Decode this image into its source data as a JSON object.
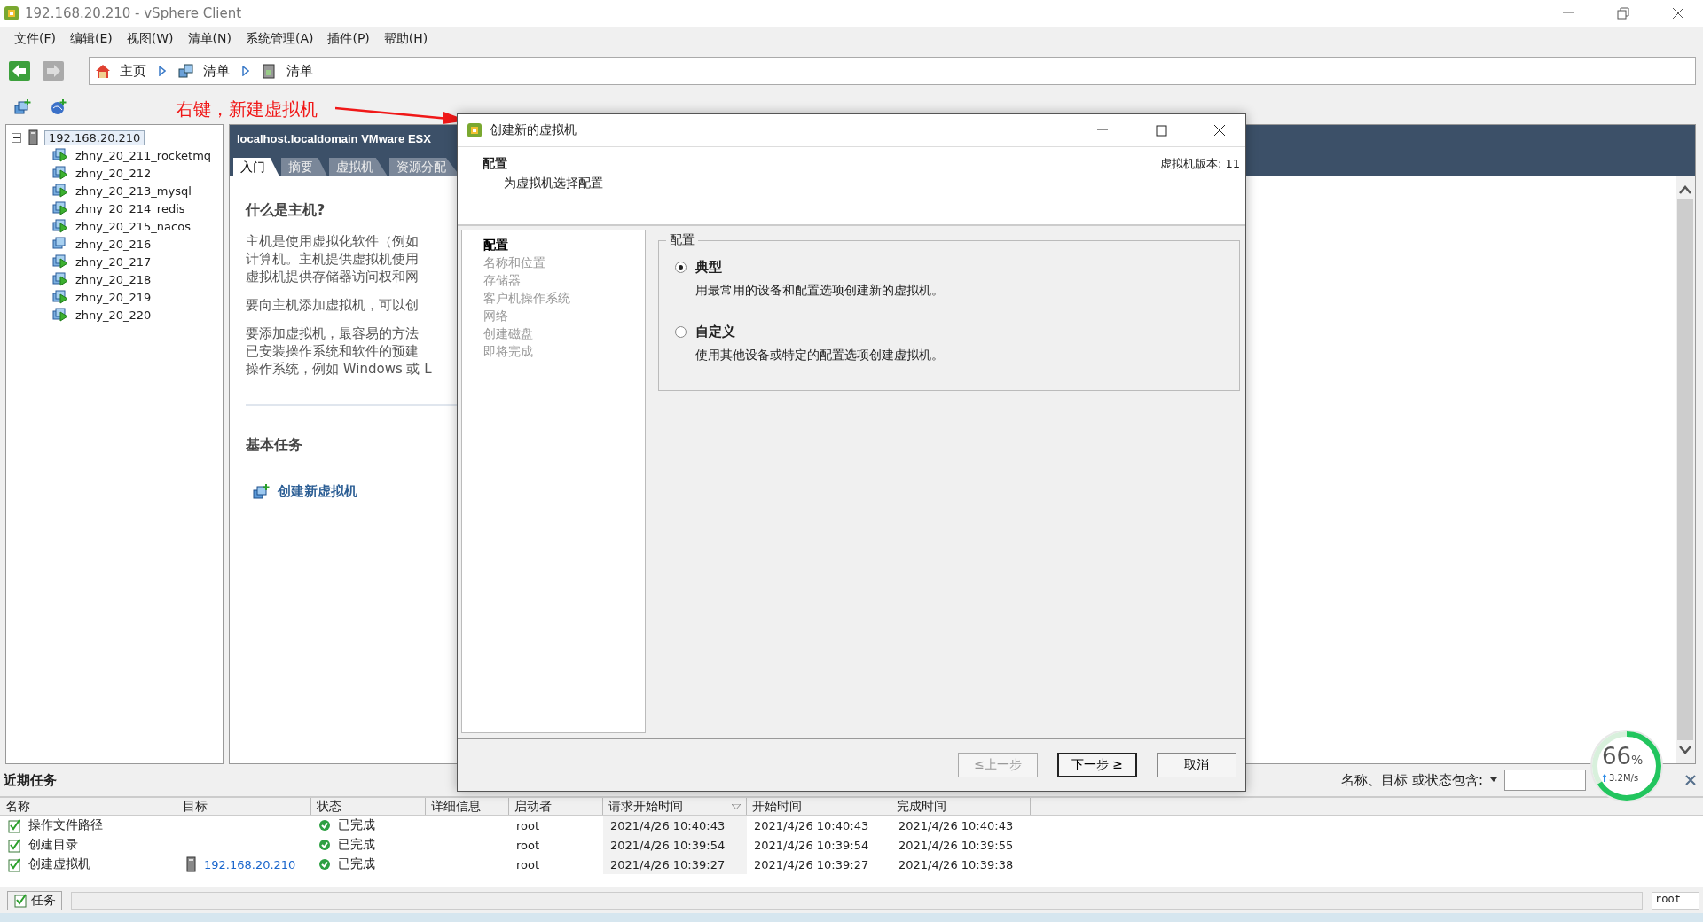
{
  "window": {
    "title": "192.168.20.210 - vSphere Client"
  },
  "menu": [
    "文件(F)",
    "编辑(E)",
    "视图(W)",
    "清单(N)",
    "系统管理(A)",
    "插件(P)",
    "帮助(H)"
  ],
  "breadcrumb": [
    {
      "kind": "home",
      "label": "主页"
    },
    {
      "kind": "inventory",
      "label": "清单"
    },
    {
      "kind": "host",
      "label": "清单"
    }
  ],
  "annotation": {
    "text": "右键，新建虚拟机"
  },
  "tree": {
    "label": "192.168.20.210",
    "expanded": true,
    "selected": true,
    "children": [
      {
        "label": "zhny_20_211_rocketmq",
        "powered_on": true,
        "selected": false
      },
      {
        "label": "zhny_20_212",
        "powered_on": true,
        "selected": false
      },
      {
        "label": "zhny_20_213_mysql",
        "powered_on": true,
        "selected": false
      },
      {
        "label": "zhny_20_214_redis",
        "powered_on": true,
        "selected": false
      },
      {
        "label": "zhny_20_215_nacos",
        "powered_on": true,
        "selected": false
      },
      {
        "label": "zhny_20_216",
        "powered_on": false,
        "selected": false
      },
      {
        "label": "zhny_20_217",
        "powered_on": true,
        "selected": false
      },
      {
        "label": "zhny_20_218",
        "powered_on": true,
        "selected": false
      },
      {
        "label": "zhny_20_219",
        "powered_on": true,
        "selected": false
      },
      {
        "label": "zhny_20_220",
        "powered_on": true,
        "selected": false
      }
    ]
  },
  "content": {
    "header": "localhost.localdomain VMware ESX",
    "tabs": [
      {
        "label": "入门",
        "selected": true
      },
      {
        "label": "摘要",
        "selected": false
      },
      {
        "label": "虚拟机",
        "selected": false
      },
      {
        "label": "资源分配",
        "selected": false
      }
    ],
    "heading": "什么是主机?",
    "paragraphs": [
      [
        "主机是使用虚拟化软件（例如",
        "计算机。主机提供虚拟机使用",
        "虚拟机提供存储器访问权和网"
      ],
      [
        "要向主机添加虚拟机，可以创"
      ],
      [
        "要添加虚拟机，最容易的方法",
        "已安装操作系统和软件的预建",
        "操作系统，例如 Windows 或 L"
      ]
    ],
    "tasks_heading": "基本任务",
    "task_link": "创建新虚拟机"
  },
  "dialog": {
    "title": "创建新的虚拟机",
    "header_title": "配置",
    "header_subtitle": "为虚拟机选择配置",
    "version": "虚拟机版本: 11",
    "steps": [
      {
        "label": "配置",
        "selected": true
      },
      {
        "label": "名称和位置",
        "selected": false
      },
      {
        "label": "存储器",
        "selected": false
      },
      {
        "label": "客户机操作系统",
        "selected": false
      },
      {
        "label": "网络",
        "selected": false
      },
      {
        "label": "创建磁盘",
        "selected": false
      },
      {
        "label": "即将完成",
        "selected": false
      }
    ],
    "group_label": "配置",
    "options": [
      {
        "title": "典型",
        "description": "用最常用的设备和配置选项创建新的虚拟机。",
        "selected": true
      },
      {
        "title": "自定义",
        "description": "使用其他设备或特定的配置选项创建虚拟机。",
        "selected": false
      }
    ],
    "buttons": [
      {
        "label": "≤上一步",
        "disabled": true,
        "default": false
      },
      {
        "label": "下一步 ≥",
        "disabled": false,
        "default": true
      },
      {
        "label": "取消",
        "disabled": false,
        "default": false
      }
    ]
  },
  "recent_tasks": {
    "title": "近期任务",
    "filter_label": "名称、目标 或状态包含:",
    "columns": [
      {
        "label": "名称",
        "sorted": false
      },
      {
        "label": "目标",
        "sorted": false
      },
      {
        "label": "状态",
        "sorted": false
      },
      {
        "label": "详细信息",
        "sorted": false
      },
      {
        "label": "启动者",
        "sorted": false
      },
      {
        "label": "请求开始时间",
        "sorted": true
      },
      {
        "label": "开始时间",
        "sorted": false
      },
      {
        "label": "完成时间",
        "sorted": false
      }
    ],
    "rows": [
      {
        "name": "操作文件路径",
        "target": "",
        "status": "已完成",
        "details": "",
        "initiator": "root",
        "requested": "2021/4/26 10:40:43",
        "started": "2021/4/26 10:40:43",
        "completed": "2021/4/26 10:40:43"
      },
      {
        "name": "创建目录",
        "target": "",
        "status": "已完成",
        "details": "",
        "initiator": "root",
        "requested": "2021/4/26 10:39:54",
        "started": "2021/4/26 10:39:54",
        "completed": "2021/4/26 10:39:55"
      },
      {
        "name": "创建虚拟机",
        "target": "192.168.20.210",
        "status": "已完成",
        "details": "",
        "initiator": "root",
        "requested": "2021/4/26 10:39:27",
        "started": "2021/4/26 10:39:27",
        "completed": "2021/4/26 10:39:38"
      }
    ]
  },
  "status_bar": {
    "tasks_label": "任务",
    "user": "root"
  },
  "network_widget": {
    "percent": "66",
    "unit": "%",
    "speed": "3.2M/s",
    "level": 0.66
  }
}
